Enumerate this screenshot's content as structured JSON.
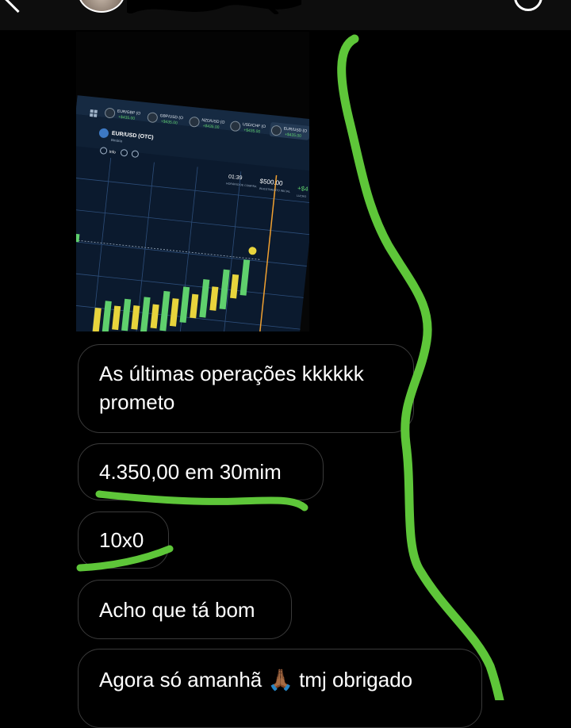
{
  "header": {
    "avatar_icon": "user-avatar",
    "back_icon": "chevron-left-icon",
    "action_icon": "circle-icon"
  },
  "photo": {
    "pairs": [
      {
        "name": "EUR/GBP (O",
        "gain": "+$435.00"
      },
      {
        "name": "GBP/USD (O",
        "gain": "+$435.00"
      },
      {
        "name": "NZD/USD (O",
        "gain": "+$435.00"
      },
      {
        "name": "USD/CHF (O",
        "gain": "+$435.00"
      },
      {
        "name": "EUR/USD (O",
        "gain": "+$435.00"
      }
    ],
    "asset": "EUR/USD (OTC)",
    "asset_sub": "Binária",
    "info": "Info",
    "timer": "01:39",
    "timer_label": "HORÁRIO DE COMPRA",
    "amount": "$500.00",
    "amount_label": "INVESTIMENTO INICIAL",
    "gain_edge": "+$4",
    "gain_edge_label": "LUCRO"
  },
  "messages": [
    {
      "lines": [
        "As últimas operações kkkkkk",
        "prometo"
      ]
    },
    {
      "lines": [
        "4.350,00 em 30mim"
      ]
    },
    {
      "lines": [
        "10x0"
      ]
    },
    {
      "lines": [
        "Acho que tá bom"
      ]
    },
    {
      "lines": [
        "Agora só amanhã 🙏🏾 tmj obrigado"
      ]
    }
  ],
  "annotation_color": "#5ec639"
}
